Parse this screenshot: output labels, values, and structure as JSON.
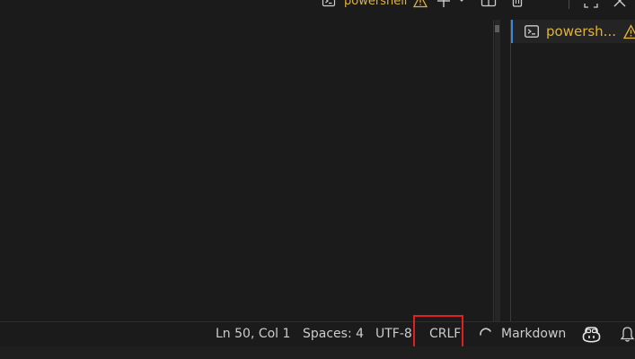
{
  "panel_toolbar": {
    "terminal_name": "powershell",
    "icons": [
      "terminal-icon",
      "warning-icon",
      "plus-icon",
      "chevron-down-icon",
      "split-icon",
      "trash-icon",
      "more-icon",
      "maximize-icon",
      "close-icon"
    ]
  },
  "terminal_list": {
    "items": [
      {
        "label": "powersh...",
        "icon": "terminal-icon",
        "status_icon": "warning-icon",
        "active": true
      }
    ]
  },
  "status_bar": {
    "position": "Ln 50, Col 1",
    "indentation": "Spaces: 4",
    "encoding": "UTF-8",
    "eol": "CRLF",
    "language": "Markdown",
    "language_icon": "loading-spinner-icon",
    "copilot_icon": "copilot-icon",
    "notifications_icon": "bell-icon"
  },
  "colors": {
    "background": "#1b1b1b",
    "warning_text": "#e0b23a",
    "status_text": "#cccccc",
    "active_border": "#3b87d6",
    "highlight_box": "#e02020"
  }
}
